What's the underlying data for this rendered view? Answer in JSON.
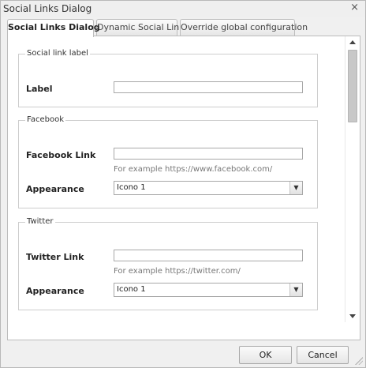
{
  "dialog": {
    "title": "Social Links Dialog",
    "close_glyph": "×"
  },
  "tabs": [
    {
      "label": "Social Links Dialog",
      "active": true
    },
    {
      "label": "Dynamic Social Links",
      "active": false
    },
    {
      "label": "Override global configuration",
      "active": false
    }
  ],
  "sections": {
    "label_section": {
      "legend": "Social link label",
      "label_field": {
        "label": "Label",
        "value": ""
      }
    },
    "facebook": {
      "legend": "Facebook",
      "link": {
        "label": "Facebook Link",
        "value": "",
        "hint": "For example https://www.facebook.com/"
      },
      "appearance": {
        "label": "Appearance",
        "value": "Icono 1"
      }
    },
    "twitter": {
      "legend": "Twitter",
      "link": {
        "label": "Twitter Link",
        "value": "",
        "hint": "For example https://twitter.com/"
      },
      "appearance": {
        "label": "Appearance",
        "value": "Icono 1"
      }
    }
  },
  "footer": {
    "ok_label": "OK",
    "cancel_label": "Cancel"
  },
  "icons": {
    "close": "close-icon",
    "dropdown": "chevron-down-icon",
    "scroll_up": "arrow-up-icon",
    "scroll_down": "arrow-down-icon",
    "resize": "resize-grip-icon"
  }
}
